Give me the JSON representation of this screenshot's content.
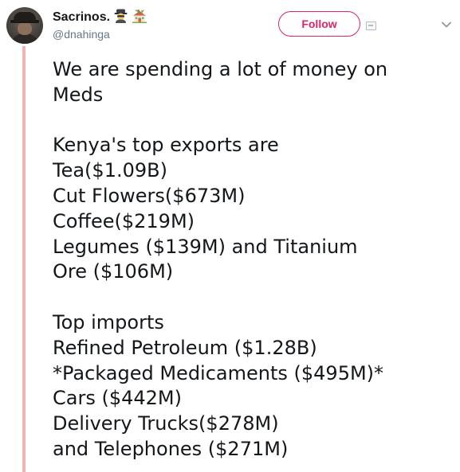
{
  "tweet": {
    "author": {
      "display_name": "Sacrinos.",
      "username": "@dnahinga",
      "name_emojis": [
        "spy-emoji",
        "house-emoji"
      ]
    },
    "follow_label": "Follow",
    "accent_color": "#e0245e",
    "thread_line_color": "#f4b2b5",
    "paragraphs": [
      [
        "We are spending a lot of money on",
        "Meds"
      ],
      [
        "Kenya's top exports are",
        "Tea($1.09B)",
        "Cut Flowers($673M)",
        "Coffee($219M)",
        "Legumes ($139M) and Titanium",
        "Ore ($106M)"
      ],
      [
        "Top imports",
        "Refined Petroleum ($1.28B)",
        "*Packaged Medicaments ($495M)*",
        "Cars ($442M)",
        "Delivery Trucks($278M)",
        "and Telephones ($271M)"
      ]
    ]
  },
  "icons": {
    "caret": "chevron-down-icon",
    "embed": "embed-badge-icon"
  }
}
